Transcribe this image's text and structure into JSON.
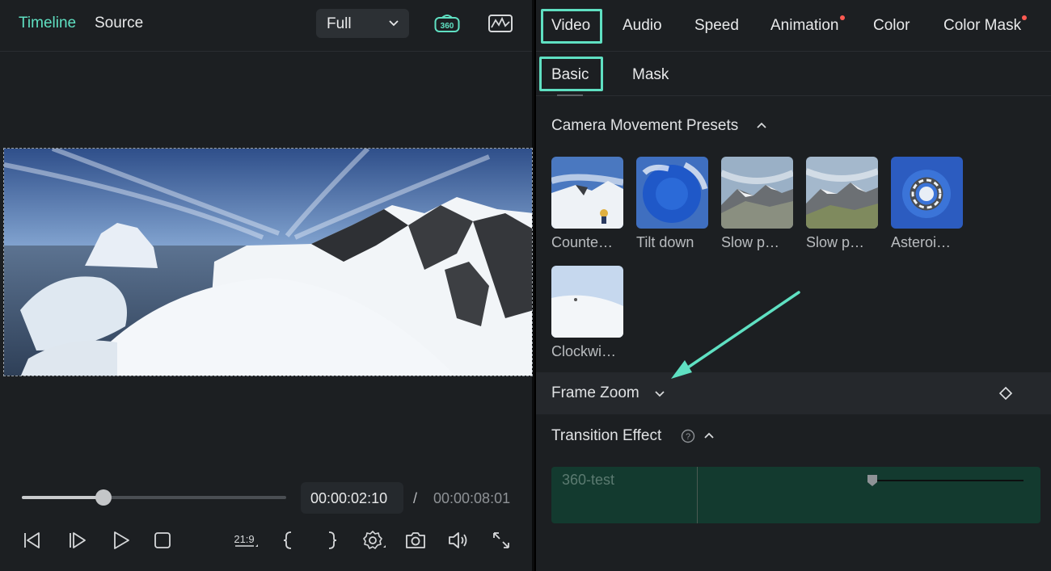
{
  "player": {
    "tabs": {
      "timeline": "Timeline",
      "source": "Source"
    },
    "quality_select": {
      "value": "Full"
    },
    "icons": {
      "view_360": "360-icon",
      "waveform": "waveform-icon"
    },
    "icon_360_label": "360",
    "progress": 0.31,
    "current_time": "00:00:02:10",
    "separator": "/",
    "total_time": "00:00:08:01",
    "aspect_label": "21:9",
    "controls": [
      "prev-frame-icon",
      "next-frame-icon",
      "play-icon",
      "stop-icon",
      "aspect-ratio-icon",
      "mark-in-icon",
      "mark-out-icon",
      "settings-icon",
      "snapshot-icon",
      "volume-icon",
      "fullscreen-icon"
    ]
  },
  "properties": {
    "tabs": [
      {
        "label": "Video",
        "active": true,
        "dot": false
      },
      {
        "label": "Audio",
        "active": false,
        "dot": false
      },
      {
        "label": "Speed",
        "active": false,
        "dot": false
      },
      {
        "label": "Animation",
        "active": false,
        "dot": true
      },
      {
        "label": "Color",
        "active": false,
        "dot": false
      },
      {
        "label": "Color Mask",
        "active": false,
        "dot": true
      }
    ],
    "sub_tabs": [
      {
        "label": "Basic",
        "active": true
      },
      {
        "label": "Mask",
        "active": false
      }
    ],
    "camera_presets": {
      "title": "Camera Movement Presets",
      "items": [
        {
          "label": "Counte…"
        },
        {
          "label": "Tilt down"
        },
        {
          "label": "Slow p…"
        },
        {
          "label": "Slow p…"
        },
        {
          "label": "Asteroi…"
        },
        {
          "label": "Clockwi…"
        }
      ]
    },
    "frame_zoom": {
      "title": "Frame Zoom"
    },
    "transition_effect": {
      "title": "Transition Effect",
      "clip_label": "360-test"
    }
  },
  "colors": {
    "accent": "#5fe0c2",
    "dot": "#ff5a52",
    "panel": "#1c1f22"
  }
}
